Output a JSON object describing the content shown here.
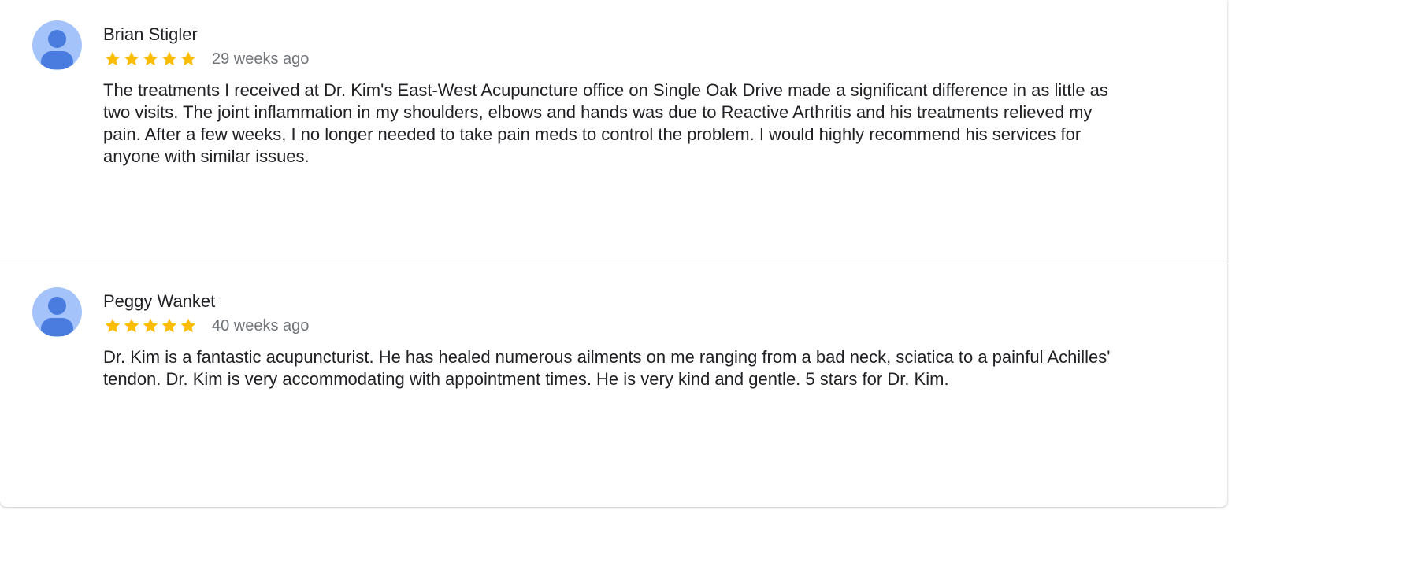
{
  "reviews": [
    {
      "author": "Brian Stigler",
      "rating": 5,
      "time_ago": "29 weeks ago",
      "text": "The treatments I received at Dr. Kim's East-West Acupuncture office on Single Oak Drive made a significant difference in as little as two visits. The joint inflammation in my shoulders, elbows and hands was due to Reactive Arthritis and his treatments relieved my pain. After a few weeks, I no longer needed to take pain meds to control the problem. I would highly recommend his services for anyone with similar issues.",
      "avatar_icon": "default-person-avatar-icon"
    },
    {
      "author": "Peggy Wanket",
      "rating": 5,
      "time_ago": "40 weeks ago",
      "text": "Dr. Kim is a fantastic acupuncturist. He has healed numerous ailments on me ranging from a bad neck, sciatica to a painful Achilles' tendon. Dr. Kim is very accommodating with appointment times. He is very kind and gentle. 5 stars for Dr. Kim.",
      "avatar_icon": "default-person-avatar-icon"
    }
  ],
  "colors": {
    "star": "#fbbc04",
    "avatar_bg": "#a5c3fb",
    "avatar_fg": "#4a7ce0",
    "time_text": "#70757a",
    "body_text": "#202124",
    "divider": "#dadce0"
  },
  "icons": {
    "star": "star-icon"
  }
}
